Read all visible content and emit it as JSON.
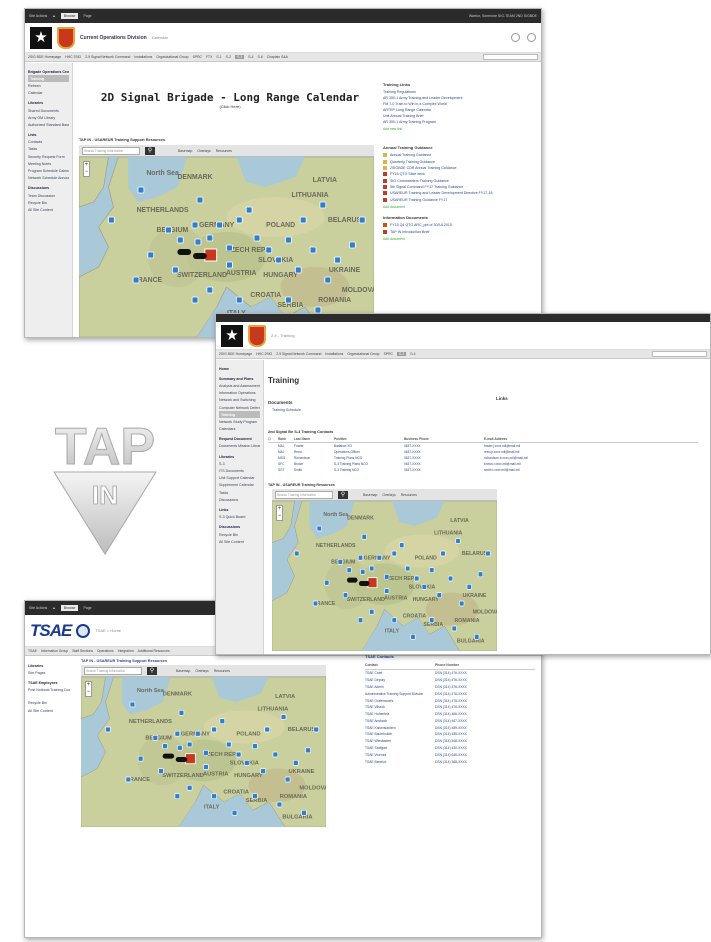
{
  "shot1": {
    "ribbon": {
      "tabs": [
        "Site Actions",
        "Browse",
        "Page"
      ],
      "right": "Warrior, Someone  SIG-TEAM 2ND SIGBDE"
    },
    "header": {
      "site_title": "Current Operations Division",
      "breadcrumb": "Calendar"
    },
    "nav": [
      "2SIG BDE Homepage",
      "HHC 2SIG",
      "2-9 Signal Network Command",
      "Installations",
      "Organizational Group",
      "SPRC",
      "FTX",
      "S-1",
      "S-2",
      "S-3",
      "S-4",
      "S-6",
      "Chaplain S&A"
    ],
    "quick_launch": [
      "Brigade Operations Center",
      "Training",
      "Refresh",
      "Calendar",
      "Libraries",
      "Shared Documents",
      "Army OM Library",
      "Authorized Standard Base Library",
      "Lists",
      "Contacts",
      "Tasks",
      "Security Request Form",
      "Meeting Notes",
      "Program Schedule Calendar",
      "Network Schedule Announcement",
      "Discussions",
      "Team Discussion",
      "Recycle Bin",
      "All Site Content"
    ],
    "page_title": "2D Signal Brigade - Long Range Calendar",
    "page_subtitle": "(Click Here)",
    "section_label": "TAP IN - USAREUR Training Support Resources",
    "map_search_placeholder": "Search Training Information",
    "map_tools": [
      "Basemap",
      "Overlays",
      "Resources"
    ],
    "training_links_title": "Training Links",
    "training_links": [
      "Training Regulations",
      "AR 350-1 Army Training and Leader Development",
      "FM 7-0 Train to Win in a Complex World",
      "ARTEP Long Range Calendar",
      "Unit Annual Training Brief",
      "AR 350-1 Army Training Program"
    ],
    "add_new_link": "Add new link",
    "annual_guidance_title": "Annual Training Guidance",
    "annual_guidance": [
      "Annual Training Guidance",
      "Quarterly Training Guidance",
      "2SIGBDE CDR Annual Training Guidance",
      "FY16 QTG Slide deck",
      "SIG Commanders Training Guidance",
      "5th Signal Command FY17 Training Guidance",
      "USAREUR Training and Leader Development Directive FY17-18",
      "USAREUR Training Guidance FY17"
    ],
    "add_document": "Add document",
    "info_docs_title": "Information Documents",
    "info_docs": [
      "FY15 Q4 QTG ARC_ppt of 30JUL2015",
      "TAP IN Introduction Brief"
    ],
    "add_document2": "Add document"
  },
  "shot2": {
    "breadcrumb": "2-9 - Training",
    "page_title": "Training",
    "documents_title": "Documents",
    "documents_item": "Training Schedule",
    "links_title": "Links",
    "contacts_title": "2nd Signal Bn S-3 Training Contacts",
    "contacts_columns": [
      "Rank",
      "Last Name",
      "Position",
      "Business Phone",
      "E-mail Address"
    ],
    "contacts_rows": [
      [
        "MAJ",
        "Fowler",
        "Battalion XO",
        "0637-XXXX",
        "fowler.j.xxxx.mil@mail.mil"
      ],
      [
        "MAJ",
        "Reed",
        "Operations Officer",
        "0637-XXXX",
        "reed.p.xxxx.mil@mail.mil"
      ],
      [
        "MSG",
        "Richardson",
        "Training Plans NCO",
        "0637-XXXX",
        "richardson.b.xxxx.mil@mail.mil"
      ],
      [
        "SFC",
        "Brown",
        "S-3 Training Plans NCO",
        "0637-XXXX",
        "brown.r.xxxx.mil@mail.mil"
      ],
      [
        "SGT",
        "Smith",
        "S-3 Training NCO",
        "0637-XXXX",
        "smith.t.xxxx.mil@mail.mil"
      ]
    ],
    "section_label": "TAP IN - USAREUR Training Resources",
    "quick_launch": [
      "Home",
      "Summary and Plans",
      "Analysis and Assessment Support",
      "Information Operations",
      "Network and Switching",
      "Computer Network Defense",
      "Training",
      "Network Study Program",
      "Calendars",
      "Request Document",
      "Documents Mission Library",
      "Libraries",
      "S-3",
      "ITS Documents",
      "Unit Support Calendar",
      "Supplement Calendar",
      "Tasks",
      "Discussions",
      "Links",
      "S-3 Quick Board",
      "Discussions",
      "Recycle Bin",
      "All Site Content"
    ],
    "map_search_placeholder": "Search Training Information",
    "map_tools": [
      "Basemap",
      "Overlays",
      "Resources"
    ]
  },
  "shot3": {
    "ribbon": {
      "tabs": [
        "Site Actions",
        "Browse",
        "Page"
      ]
    },
    "logo": "TSAE",
    "breadcrumb": "TSAE > Home",
    "nav": [
      "TSAE",
      "Information Group",
      "Staff Sections",
      "Operations",
      "Integration",
      "Additional Resources"
    ],
    "quick_launch": [
      "Libraries",
      "Site Pages",
      "TSAE Employees",
      "Post Notional Training Documentation",
      "Recycle Bin",
      "All Site Content"
    ],
    "section_label": "TAP IN - USAREUR Training Support Resources",
    "map_search_placeholder": "Search Training Information",
    "map_tools": [
      "Basemap",
      "Overlays",
      "Resources"
    ],
    "contacts_title": "TSAE Contacts",
    "contacts_columns": [
      "Contact",
      "Phone Number"
    ],
    "contacts": [
      [
        "TSAE Chief",
        "DSN (314) 476-XXXX"
      ],
      [
        "TSAE Deputy",
        "DSN (314) 476-XXXX"
      ],
      [
        "TSAE Admin",
        "DSN (314) 476-XXXX"
      ],
      [
        "Administrative Training Support Division",
        "DSN (314) 476-XXXX"
      ],
      [
        "TSAE Grafenwoehr",
        "DSN (314) 475-XXXX"
      ],
      [
        "TSAE Vilseck",
        "DSN (314) 476-XXXX"
      ],
      [
        "TSAE Hohenfels",
        "DSN (314) 466-XXXX"
      ],
      [
        "TSAE Ansbach",
        "DSN (314) 467-XXXX"
      ],
      [
        "TSAE Kaiserslautern",
        "DSN (314) 489-XXXX"
      ],
      [
        "TSAE Baumholder",
        "DSN (314) 485-XXXX"
      ],
      [
        "TSAE Wiesbaden",
        "DSN (314) 548-XXXX"
      ],
      [
        "TSAE Stuttgart",
        "DSN (314) 430-XXXX"
      ],
      [
        "TSAE Vicenza",
        "DSN (314) 646-XXXX"
      ],
      [
        "TSAE Benelux",
        "DSN (314) 368-XXXX"
      ]
    ]
  },
  "tap_in": {
    "line1": "TAP",
    "line2": "IN"
  },
  "map_labels": [
    "North Sea",
    "DENMARK",
    "NETHERLANDS",
    "GERMANY",
    "POLAND",
    "BELARUS",
    "UKRAINE",
    "FRANCE",
    "AUSTRIA",
    "ITALY",
    "BELGIUM",
    "CZECH REP.",
    "HUNGARY",
    "ROMANIA",
    "SERBIA",
    "CROATIA",
    "SWITZERLAND",
    "SLOVAKIA",
    "MOLDOVA",
    "BULGARIA",
    "LITHUANIA",
    "LATVIA"
  ],
  "colors": {
    "ribbon": "#2b2b2b",
    "link": "#2a4a86",
    "nav_bg": "#e6e6e6",
    "army_gold": "#e8a23a",
    "shield_red": "#c8381e",
    "tsae_blue": "#1a3a8a"
  }
}
